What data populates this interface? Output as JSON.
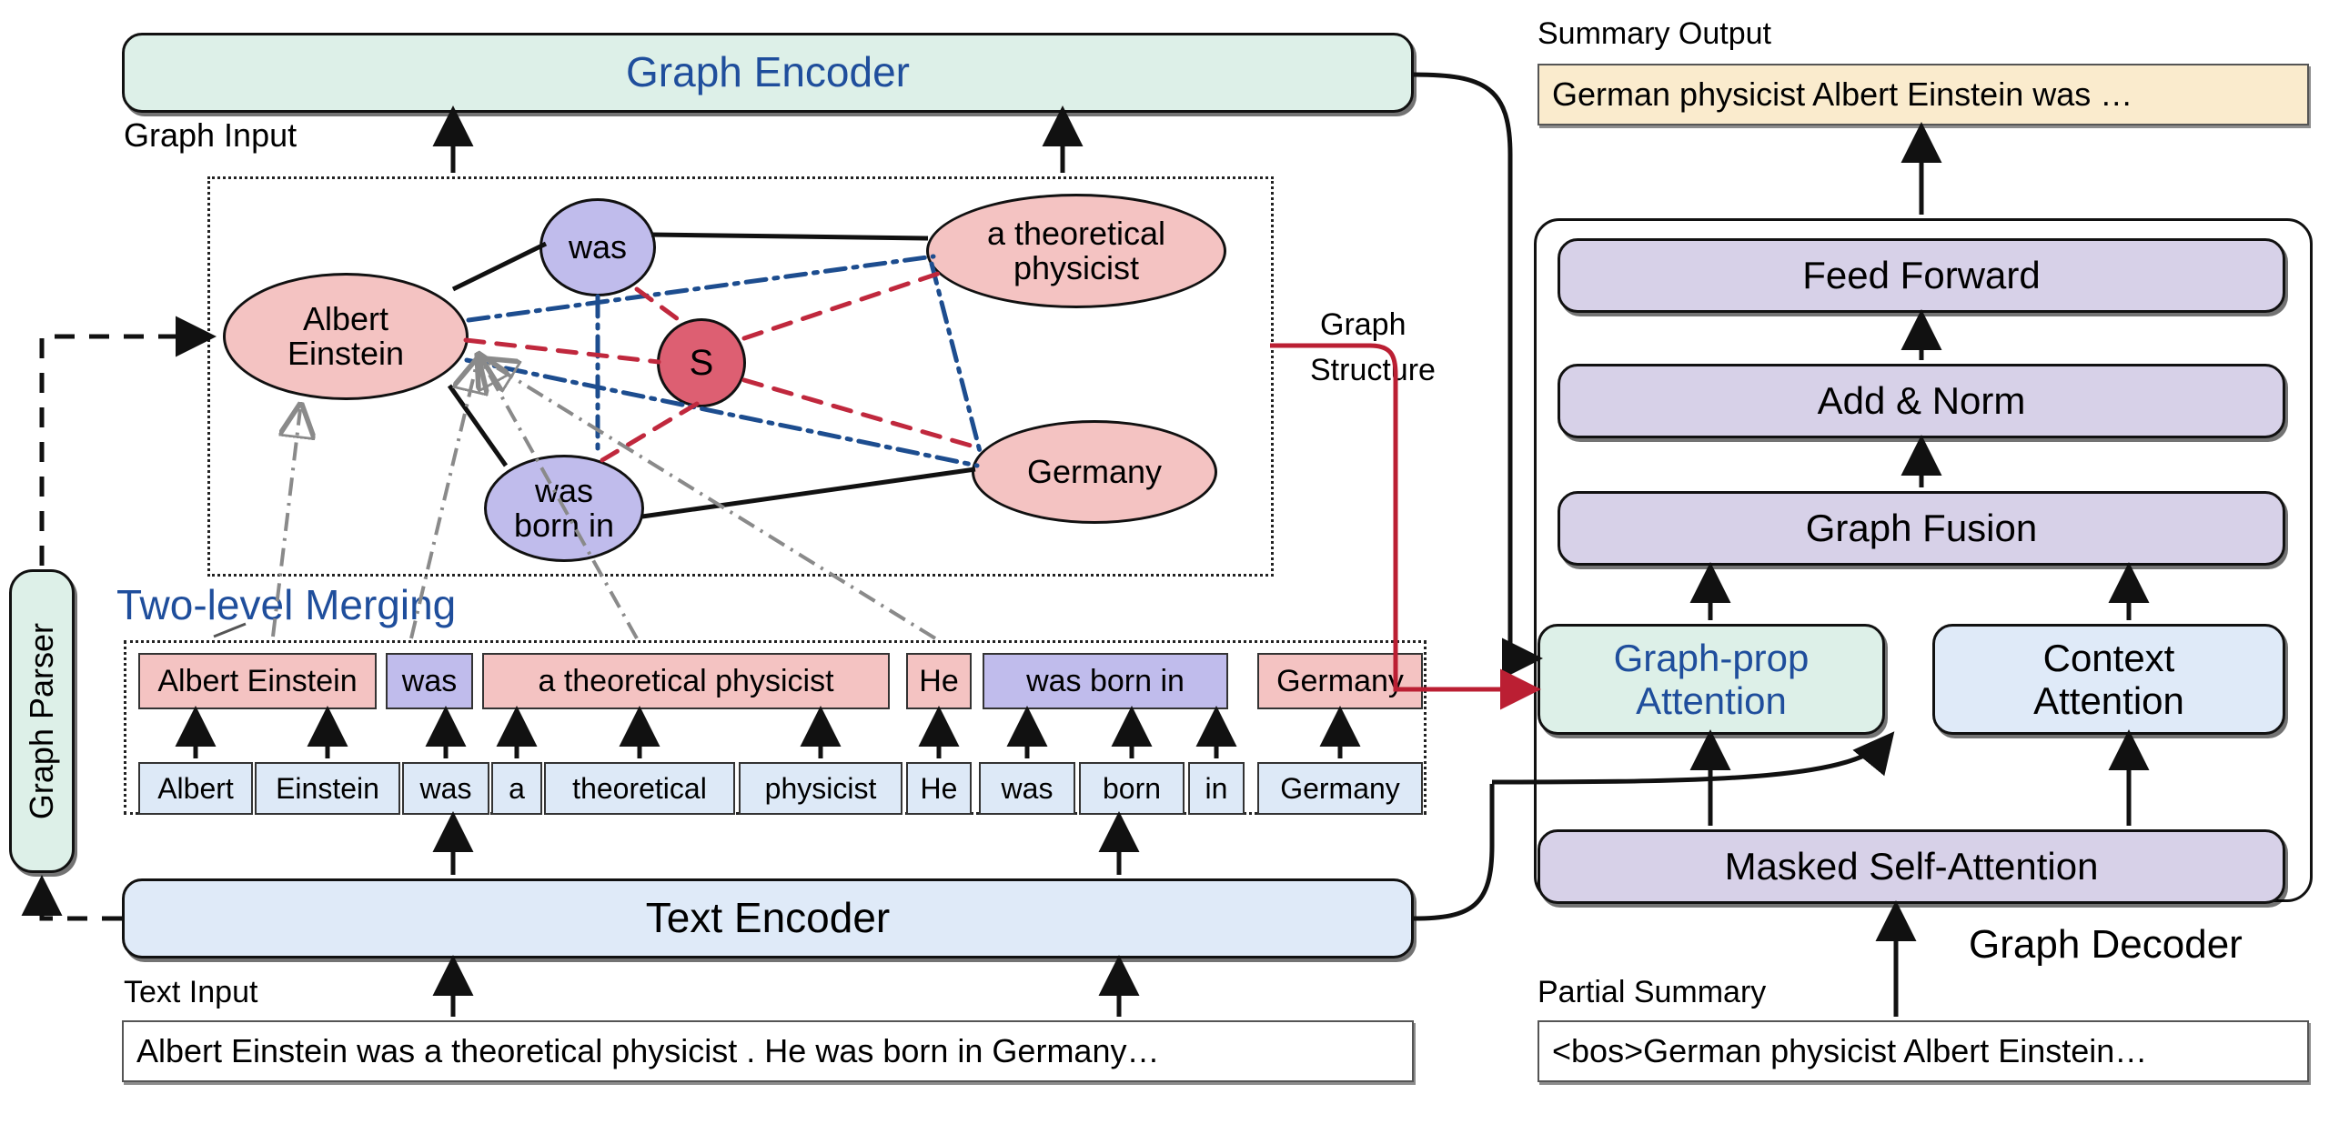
{
  "colors": {
    "encoder_mint": "#ddf0e8",
    "encoder_blue": "#dfeaf8",
    "entity_pink": "#f4c3c2",
    "relation_lavender": "#c0bcec",
    "sentence_red": "#dd5f72",
    "decoder_lavender": "#d7d1e8",
    "context_blue": "#dfeaf8",
    "summary_cream": "#faebcd",
    "token_blue": "#dde9f7",
    "title_blue": "#1f4e9c",
    "edge_black": "#111111",
    "edge_blue": "#1d4d8f",
    "edge_red": "#c0283d",
    "edge_grey": "#8a8a8a",
    "graph_structure_red": "#bb1f33"
  },
  "left": {
    "graph_encoder_label": "Graph Encoder",
    "graph_input_label": "Graph Input",
    "two_level_merging_label": "Two-level Merging",
    "text_encoder_label": "Text Encoder",
    "text_input_label": "Text Input",
    "graph_parser_label": "Graph Parser",
    "text_input_value": "Albert Einstein was a theoretical physicist . He was born in Germany…"
  },
  "graph": {
    "nodes": [
      {
        "id": "albert_einstein",
        "label": "Albert\nEinstein",
        "type": "entity"
      },
      {
        "id": "was",
        "label": "was",
        "type": "relation"
      },
      {
        "id": "a_theoretical_physicist",
        "label": "a theoretical\nphysicist",
        "type": "entity"
      },
      {
        "id": "sentence",
        "label": "S",
        "type": "sentence"
      },
      {
        "id": "was_born_in",
        "label": "was\nborn in",
        "type": "relation"
      },
      {
        "id": "germany",
        "label": "Germany",
        "type": "entity"
      }
    ],
    "edge_types": [
      {
        "name": "graph-edge-solid",
        "style": "solid",
        "color": "#111111"
      },
      {
        "name": "graph-edge-blue-dashdot",
        "style": "dash-dot",
        "color": "#1d4d8f"
      },
      {
        "name": "graph-edge-red-dashed",
        "style": "dashed",
        "color": "#c0283d"
      },
      {
        "name": "merge-arrow-grey",
        "style": "dash-dot-arrow",
        "color": "#8a8a8a"
      }
    ]
  },
  "spans": [
    {
      "text": "Albert Einstein",
      "type": "entity"
    },
    {
      "text": "was",
      "type": "relation"
    },
    {
      "text": "a theoretical  physicist",
      "type": "entity"
    },
    {
      "text": "He",
      "type": "entity"
    },
    {
      "text": "was born in",
      "type": "relation"
    },
    {
      "text": "Germany",
      "type": "entity"
    }
  ],
  "tokens": [
    "Albert",
    "Einstein",
    "was",
    "a",
    "theoretical",
    "physicist",
    "He",
    "was",
    "born",
    "in",
    "Germany"
  ],
  "connector": {
    "graph_structure_label_line1": "Graph",
    "graph_structure_label_line2": "Structure"
  },
  "right": {
    "summary_output_label": "Summary Output",
    "summary_output_value": "German physicist Albert Einstein was …",
    "graph_decoder_label": "Graph Decoder",
    "partial_summary_label": "Partial Summary",
    "partial_summary_value": "<bos>German physicist Albert Einstein…",
    "stack": [
      {
        "id": "feed-forward",
        "label": "Feed Forward",
        "fill": "#d7d1e8",
        "text_color": "#000000"
      },
      {
        "id": "add-norm",
        "label": "Add & Norm",
        "fill": "#d7d1e8",
        "text_color": "#000000"
      },
      {
        "id": "graph-fusion",
        "label": "Graph Fusion",
        "fill": "#d7d1e8",
        "text_color": "#000000"
      }
    ],
    "attention": [
      {
        "id": "graph-prop-attention",
        "label": "Graph-prop\nAttention",
        "fill": "#ddf0e8",
        "text_color": "#1f4e9c"
      },
      {
        "id": "context-attention",
        "label": "Context\nAttention",
        "fill": "#dfeaf8",
        "text_color": "#000000"
      }
    ],
    "masked_self_attention": {
      "id": "masked-self-attention",
      "label": "Masked Self-Attention",
      "fill": "#d7d1e8"
    }
  }
}
